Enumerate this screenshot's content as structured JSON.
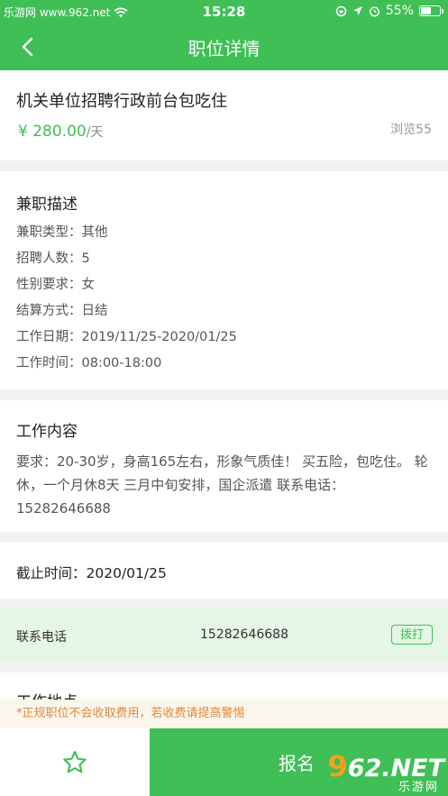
{
  "status_bar": {
    "left_text": "乐游网 www.962.net",
    "time": "15:28",
    "battery_percent": "55%",
    "battery_level": 0.55
  },
  "nav": {
    "title": "职位详情"
  },
  "job": {
    "title": "机关单位招聘行政前台包吃住",
    "price": "¥ 280.00",
    "price_unit": "/天",
    "views": "浏览55"
  },
  "description": {
    "heading": "兼职描述",
    "items": [
      "兼职类型：其他",
      "招聘人数：5",
      "性别要求：女",
      "结算方式：日结",
      "工作日期：2019/11/25-2020/01/25",
      "工作时间：08:00-18:00"
    ]
  },
  "work_content": {
    "heading": "工作内容",
    "text": "要求：20-30岁，身高165左右，形象气质佳！ 买五险，包吃住。 轮休，一个月休8天 三月中旬安排，国企派遣 联系电话：15282646688"
  },
  "deadline": {
    "text": "截止时间：2020/01/25"
  },
  "contact": {
    "label": "联系电话",
    "phone": "15282646688",
    "call_label": "拨打"
  },
  "location": {
    "heading": "工作地点"
  },
  "notice": {
    "text": "*正规职位不会收取费用，若收费请提高警惕"
  },
  "bottom_bar": {
    "apply_label": "报名"
  },
  "watermark": {
    "logo_prefix": "9",
    "logo_rest": "62.NET",
    "sub": "乐游网"
  },
  "colors": {
    "brand_green": "#3fbf55",
    "contact_bg": "#e5f5e6",
    "notice_text": "#e0883a",
    "watermark_orange": "#f7a01d"
  }
}
